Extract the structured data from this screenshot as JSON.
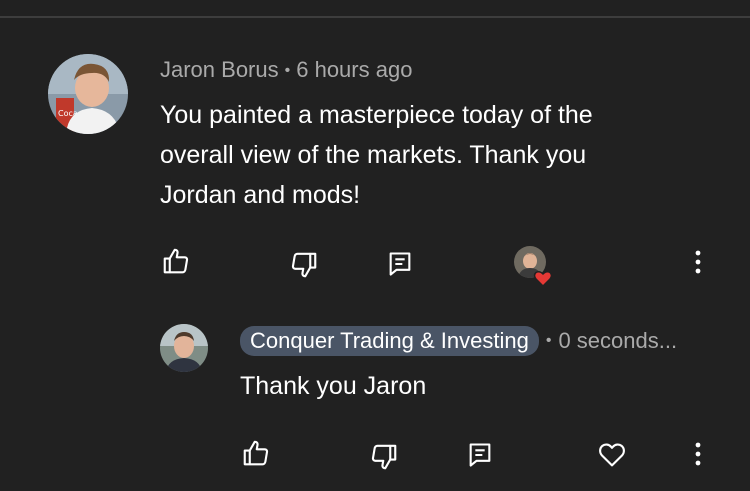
{
  "comment": {
    "author": "Jaron Borus",
    "time": "6 hours ago",
    "separator": "•",
    "lines": [
      "You painted a masterpiece today of the",
      "overall view of the markets. Thank you",
      "Jordan and mods!"
    ],
    "actions": {
      "like": "thumbs-up-icon",
      "dislike": "thumbs-down-icon",
      "reply": "reply-comment-icon",
      "hearted_by": "creator-heart-avatar",
      "more": "more-vertical-icon"
    }
  },
  "reply": {
    "author": "Conquer Trading & Investing",
    "time": "0 seconds...",
    "separator": "•",
    "text": "Thank you Jaron",
    "actions": {
      "like": "thumbs-up-icon",
      "dislike": "thumbs-down-icon",
      "reply": "reply-comment-icon",
      "heart": "heart-outline-icon",
      "more": "more-vertical-icon"
    }
  },
  "colors": {
    "background": "#212121",
    "meta_text": "#aaaaaa",
    "badge_bg": "#4a5566",
    "heart_red": "#e53935"
  }
}
